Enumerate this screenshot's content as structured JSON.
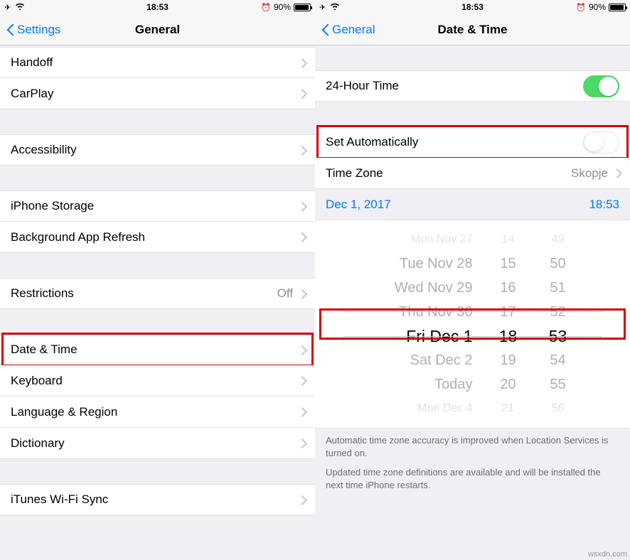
{
  "status": {
    "time": "18:53",
    "battery_pct": "90%"
  },
  "left": {
    "back_label": "Settings",
    "title": "General",
    "items": {
      "handoff": "Handoff",
      "carplay": "CarPlay",
      "accessibility": "Accessibility",
      "iphone_storage": "iPhone Storage",
      "background_refresh": "Background App Refresh",
      "restrictions": "Restrictions",
      "restrictions_value": "Off",
      "date_time": "Date & Time",
      "keyboard": "Keyboard",
      "language_region": "Language & Region",
      "dictionary": "Dictionary",
      "itunes_wifi_sync": "iTunes Wi-Fi Sync"
    }
  },
  "right": {
    "back_label": "General",
    "title": "Date & Time",
    "items": {
      "twenty_four": "24-Hour Time",
      "set_auto": "Set Automatically",
      "time_zone": "Time Zone",
      "time_zone_value": "Skopje"
    },
    "date_row": {
      "date": "Dec 1, 2017",
      "time": "18:53"
    },
    "picker": {
      "rows": [
        {
          "d": "Mon Nov 27",
          "h": "14",
          "m": "49"
        },
        {
          "d": "Tue Nov 28",
          "h": "15",
          "m": "50"
        },
        {
          "d": "Wed Nov 29",
          "h": "16",
          "m": "51"
        },
        {
          "d": "Thu Nov 30",
          "h": "17",
          "m": "52"
        },
        {
          "d": "Fri Dec 1",
          "h": "18",
          "m": "53"
        },
        {
          "d": "Sat Dec 2",
          "h": "19",
          "m": "54"
        },
        {
          "d": "Today",
          "h": "20",
          "m": "55"
        },
        {
          "d": "Mon Dec 4",
          "h": "21",
          "m": "56"
        }
      ]
    },
    "footer": {
      "p1": "Automatic time zone accuracy is improved when Location Services is turned on.",
      "p2": "Updated time zone definitions are available and will be installed the next time iPhone restarts."
    }
  },
  "credit": "wsxdn.com"
}
